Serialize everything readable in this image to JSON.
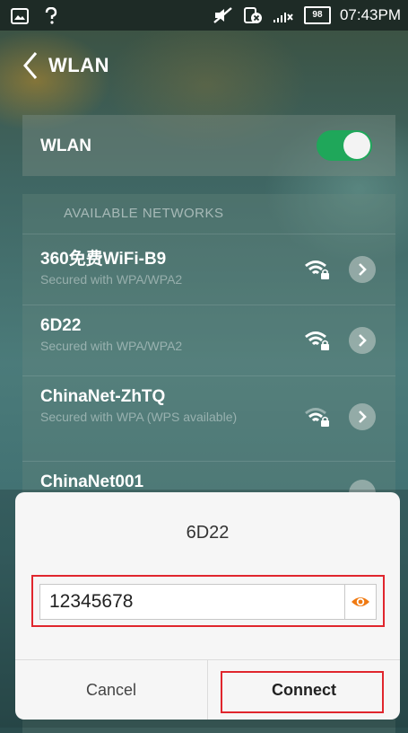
{
  "statusbar": {
    "time": "07:43PM",
    "battery": "98"
  },
  "header": {
    "title": "WLAN"
  },
  "wlan_toggle": {
    "label": "WLAN",
    "state": "on"
  },
  "section": {
    "label": "AVAILABLE NETWORKS"
  },
  "networks": [
    {
      "name": "360免费WiFi-B9",
      "security": "Secured with WPA/WPA2"
    },
    {
      "name": "6D22",
      "security": "Secured with WPA/WPA2"
    },
    {
      "name": "ChinaNet-ZhTQ",
      "security": "Secured with WPA (WPS available)"
    },
    {
      "name": "ChinaNet001",
      "security": ""
    }
  ],
  "dialog": {
    "title": "6D22",
    "password_value": "12345678",
    "cancel_label": "Cancel",
    "connect_label": "Connect"
  },
  "colors": {
    "toggle_on": "#1fa75a",
    "eye_icon": "#f07a12",
    "highlight": "#e0262d"
  }
}
